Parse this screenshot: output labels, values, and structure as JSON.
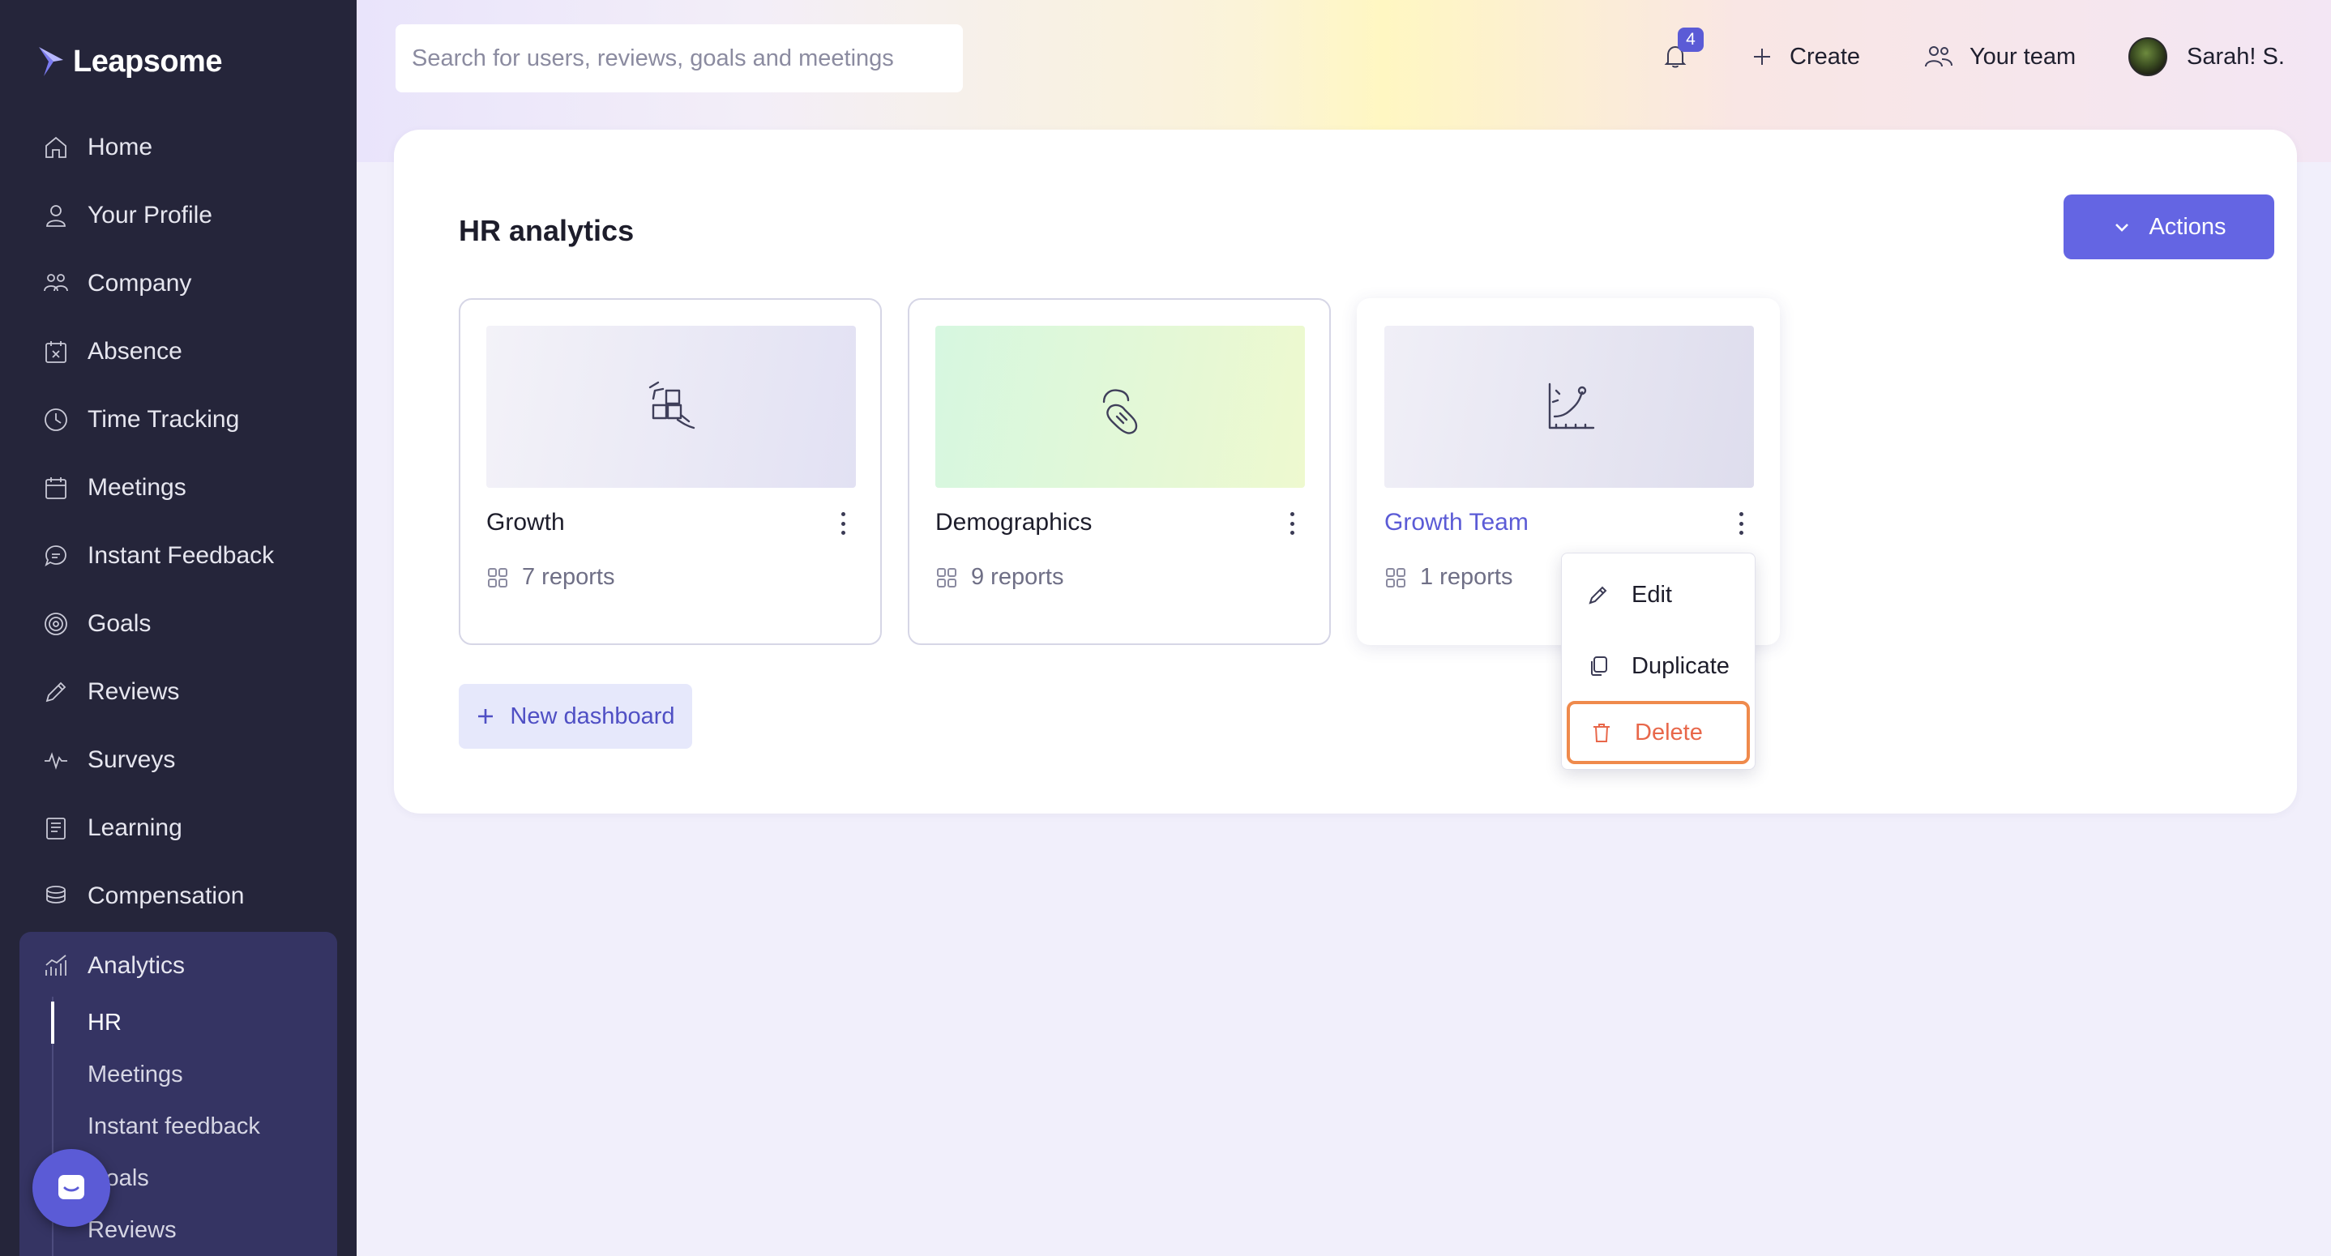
{
  "brand": {
    "name": "Leapsome"
  },
  "sidebar": {
    "items": [
      {
        "label": "Home",
        "icon": "home-icon"
      },
      {
        "label": "Your Profile",
        "icon": "user-icon"
      },
      {
        "label": "Company",
        "icon": "users-icon"
      },
      {
        "label": "Absence",
        "icon": "calendar-x-icon"
      },
      {
        "label": "Time Tracking",
        "icon": "clock-icon"
      },
      {
        "label": "Meetings",
        "icon": "calendar-icon"
      },
      {
        "label": "Instant Feedback",
        "icon": "chat-icon"
      },
      {
        "label": "Goals",
        "icon": "target-icon"
      },
      {
        "label": "Reviews",
        "icon": "pencil-icon"
      },
      {
        "label": "Surveys",
        "icon": "pulse-icon"
      },
      {
        "label": "Learning",
        "icon": "book-icon"
      },
      {
        "label": "Compensation",
        "icon": "coins-icon"
      }
    ],
    "analytics": {
      "label": "Analytics",
      "icon": "analytics-icon",
      "subitems": [
        "HR",
        "Meetings",
        "Instant feedback",
        "Goals",
        "Reviews"
      ],
      "active": "HR"
    }
  },
  "topbar": {
    "search_placeholder": "Search for users, reviews, goals and meetings",
    "notifications_count": "4",
    "create_label": "Create",
    "team_label": "Your team",
    "user_name": "Sarah! S."
  },
  "page": {
    "title": "HR analytics",
    "actions_label": "Actions",
    "new_dashboard_label": "New dashboard",
    "dashboards": [
      {
        "name": "Growth",
        "reports": "7 reports"
      },
      {
        "name": "Demographics",
        "reports": "9 reports"
      },
      {
        "name": "Growth Team",
        "reports": "1 reports"
      }
    ]
  },
  "context_menu": {
    "edit": "Edit",
    "duplicate": "Duplicate",
    "delete": "Delete"
  },
  "colors": {
    "sidebar_bg": "#25253a",
    "accent": "#6465e3",
    "danger": "#e8674a"
  }
}
